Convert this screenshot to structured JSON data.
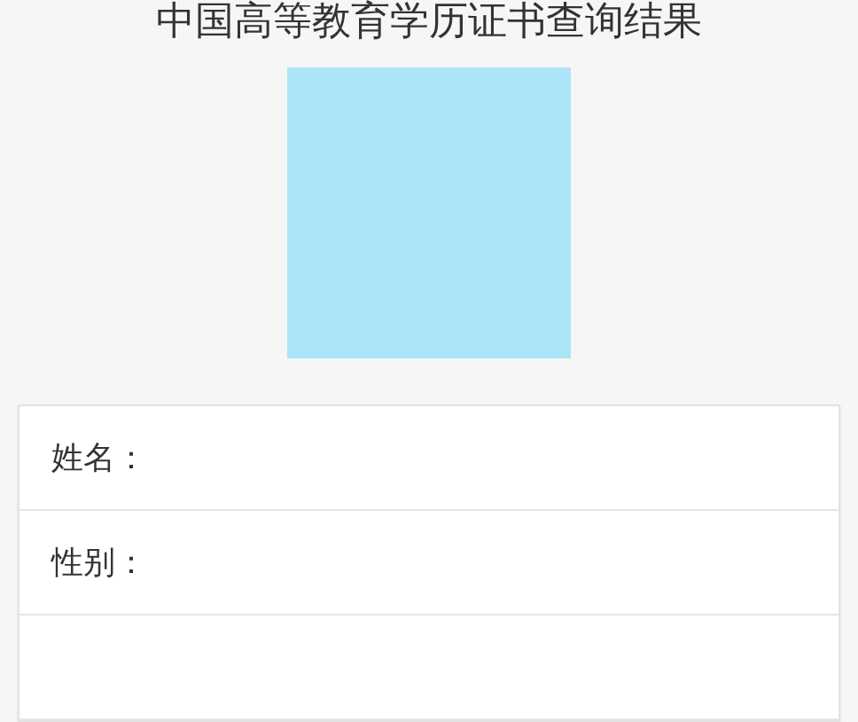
{
  "title": "中国高等教育学历证书查询结果",
  "photo": {
    "kind": "placeholder"
  },
  "fields": [
    {
      "label": "姓名："
    },
    {
      "label": "性别："
    }
  ]
}
